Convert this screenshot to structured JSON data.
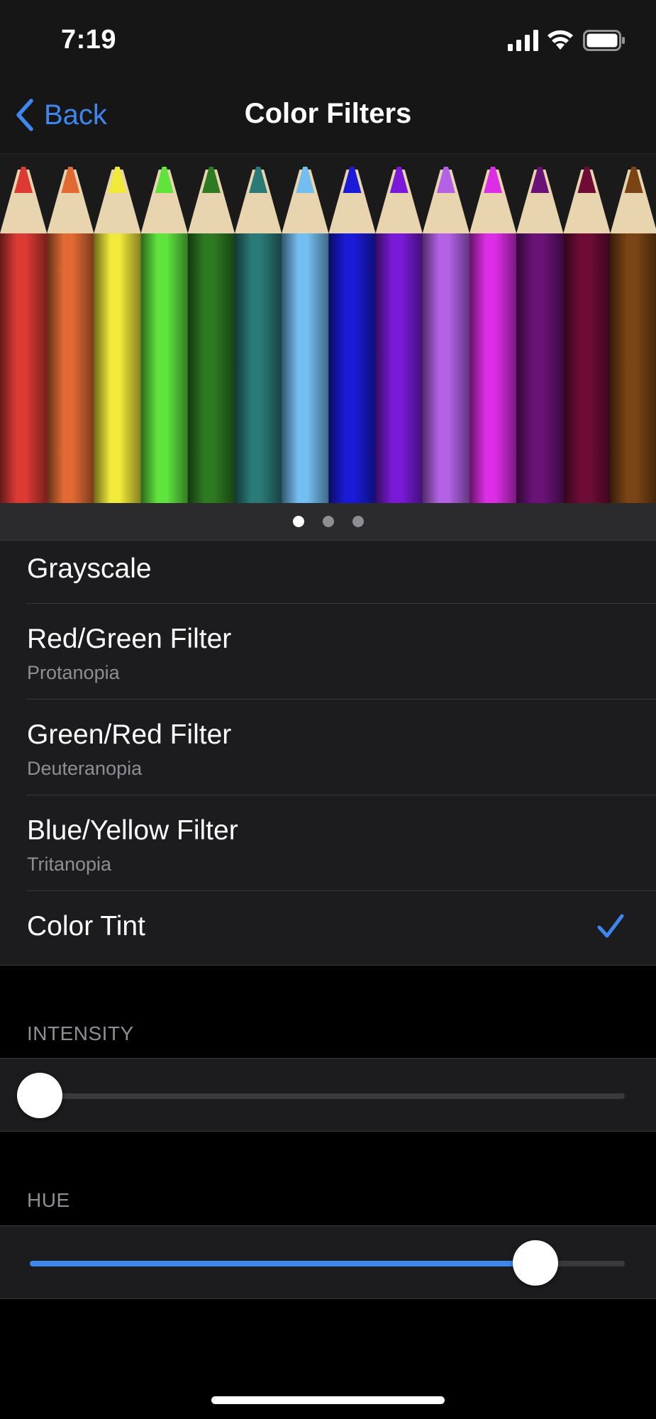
{
  "status_bar": {
    "time": "7:19",
    "icons": [
      "signal-icon",
      "wifi-icon",
      "battery-icon"
    ]
  },
  "nav": {
    "back_label": "Back",
    "title": "Color Filters"
  },
  "banner": {
    "image": "colored-pencils",
    "pencil_colors": [
      "#dd3a34",
      "#e06a32",
      "#f2ea3a",
      "#5fe43e",
      "#2d7a22",
      "#2a7a78",
      "#72bef0",
      "#1a1ad8",
      "#7a1ad8",
      "#b362e6",
      "#dd2de6",
      "#6a1277",
      "#6e0c36",
      "#7a4414"
    ],
    "page_count": 3,
    "current_page": 1
  },
  "filters": [
    {
      "title": "Grayscale",
      "subtitle": "",
      "selected": false
    },
    {
      "title": "Red/Green Filter",
      "subtitle": "Protanopia",
      "selected": false
    },
    {
      "title": "Green/Red Filter",
      "subtitle": "Deuteranopia",
      "selected": false
    },
    {
      "title": "Blue/Yellow Filter",
      "subtitle": "Tritanopia",
      "selected": false
    },
    {
      "title": "Color Tint",
      "subtitle": "",
      "selected": true
    }
  ],
  "intensity": {
    "header": "INTENSITY",
    "value": 0.0
  },
  "hue": {
    "header": "HUE",
    "value": 0.85
  },
  "colors": {
    "accent": "#3d87ef",
    "background": "#000000",
    "cell": "#1c1c1e",
    "secondary_text": "#8e8e93"
  }
}
